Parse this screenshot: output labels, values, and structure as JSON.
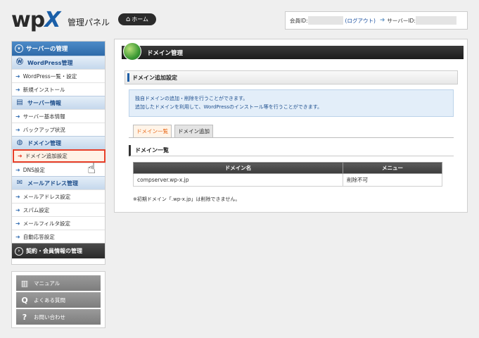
{
  "header": {
    "logo_main": "wp",
    "logo_x": "X",
    "logo_sub": "管理パネル",
    "home_label": "ホーム",
    "member_label": "会員ID:",
    "logout_label": "(ログアウト)",
    "server_label": "サーバーID:"
  },
  "sidebar": {
    "top_label": "サーバーの管理",
    "sections": [
      {
        "title": "WordPress管理",
        "items": [
          "WordPress一覧・設定",
          "新規インストール"
        ]
      },
      {
        "title": "サーバー情報",
        "items": [
          "サーバー基本情報",
          "バックアップ状況"
        ]
      },
      {
        "title": "ドメイン管理",
        "items": [
          "ドメイン追加設定",
          "DNS設定"
        ]
      },
      {
        "title": "メールアドレス管理",
        "items": [
          "メールアドレス設定",
          "スパム設定",
          "メールフィルタ設定",
          "自動応答設定"
        ]
      }
    ],
    "bottom_label": "契約・会員情報の管理"
  },
  "help": {
    "manual": "マニュアル",
    "faq": "よくある質問",
    "contact": "お問い合わせ"
  },
  "main": {
    "header_title": "ドメイン管理",
    "sub_title": "ドメイン追加設定",
    "info_line1": "独自ドメインの追加・削除を行うことができます。",
    "info_line2": "追加したドメインを利用して、WordPressのインストール等を行うことができます。",
    "tabs": [
      {
        "label": "ドメイン一覧"
      },
      {
        "label": "ドメイン追加"
      }
    ],
    "section_title": "ドメイン一覧",
    "table": {
      "headers": [
        "ドメイン名",
        "メニュー"
      ],
      "rows": [
        [
          "compserver.wp-x.jp",
          "削除不可"
        ]
      ]
    },
    "note": "※初期ドメイン「.wp-x.jp」は削除できません。"
  },
  "colors": {
    "brand_blue": "#2e6aa9",
    "active_red": "#e8402a",
    "active_tab_orange": "#e86a1a",
    "info_bg": "#e3eef9"
  }
}
